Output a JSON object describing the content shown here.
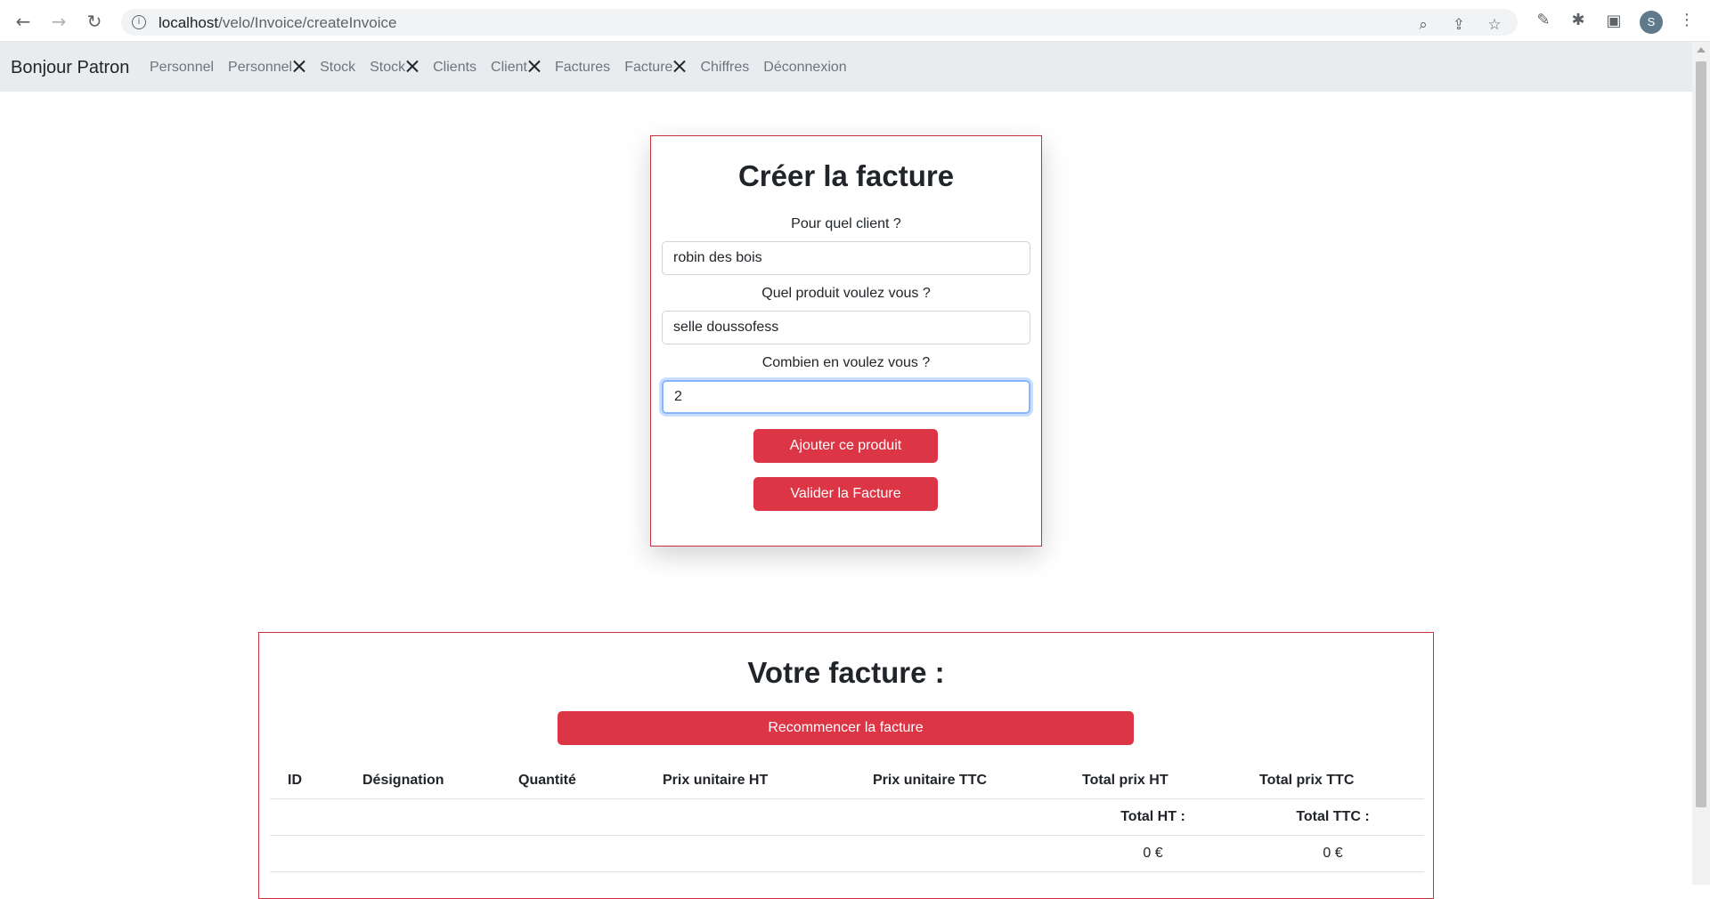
{
  "browser": {
    "url_host": "localhost",
    "url_path": "/velo/Invoice/createInvoice",
    "icons": [
      "back-icon",
      "forward-icon",
      "reload-icon",
      "info-icon",
      "zoom-icon",
      "share-icon",
      "star-icon",
      "eyedropper-icon",
      "extensions-icon",
      "sidepanel-icon",
      "menu-icon"
    ],
    "avatar_letter": "S"
  },
  "navbar": {
    "brand": "Bonjour Patron",
    "links": [
      {
        "label": "Personnel"
      },
      {
        "label": "Personnel",
        "tool": true
      },
      {
        "label": "Stock"
      },
      {
        "label": "Stock",
        "tool": true
      },
      {
        "label": "Clients"
      },
      {
        "label": "Client",
        "tool": true
      },
      {
        "label": "Factures"
      },
      {
        "label": "Facture",
        "tool": true
      },
      {
        "label": "Chiffres"
      },
      {
        "label": "Déconnexion"
      }
    ]
  },
  "create_form": {
    "title": "Créer la facture",
    "client_label": "Pour quel client ?",
    "client_value": "robin des bois",
    "product_label": "Quel produit voulez vous ?",
    "product_value": "selle doussofess",
    "quantity_label": "Combien en voulez vous ?",
    "quantity_value": "2",
    "add_button": "Ajouter ce produit",
    "validate_button": "Valider la Facture"
  },
  "invoice": {
    "title": "Votre facture :",
    "restart_button": "Recommencer la facture",
    "columns": [
      "ID",
      "Désignation",
      "Quantité",
      "Prix unitaire HT",
      "Prix unitaire TTC",
      "Total prix HT",
      "Total prix TTC"
    ],
    "total_ht_label": "Total HT :",
    "total_ttc_label": "Total TTC :",
    "total_ht_value": "0 €",
    "total_ttc_value": "0 €"
  },
  "colors": {
    "accent": "#dc3545",
    "navbar_bg": "#e9ecef",
    "focus": "#86b7fe"
  }
}
